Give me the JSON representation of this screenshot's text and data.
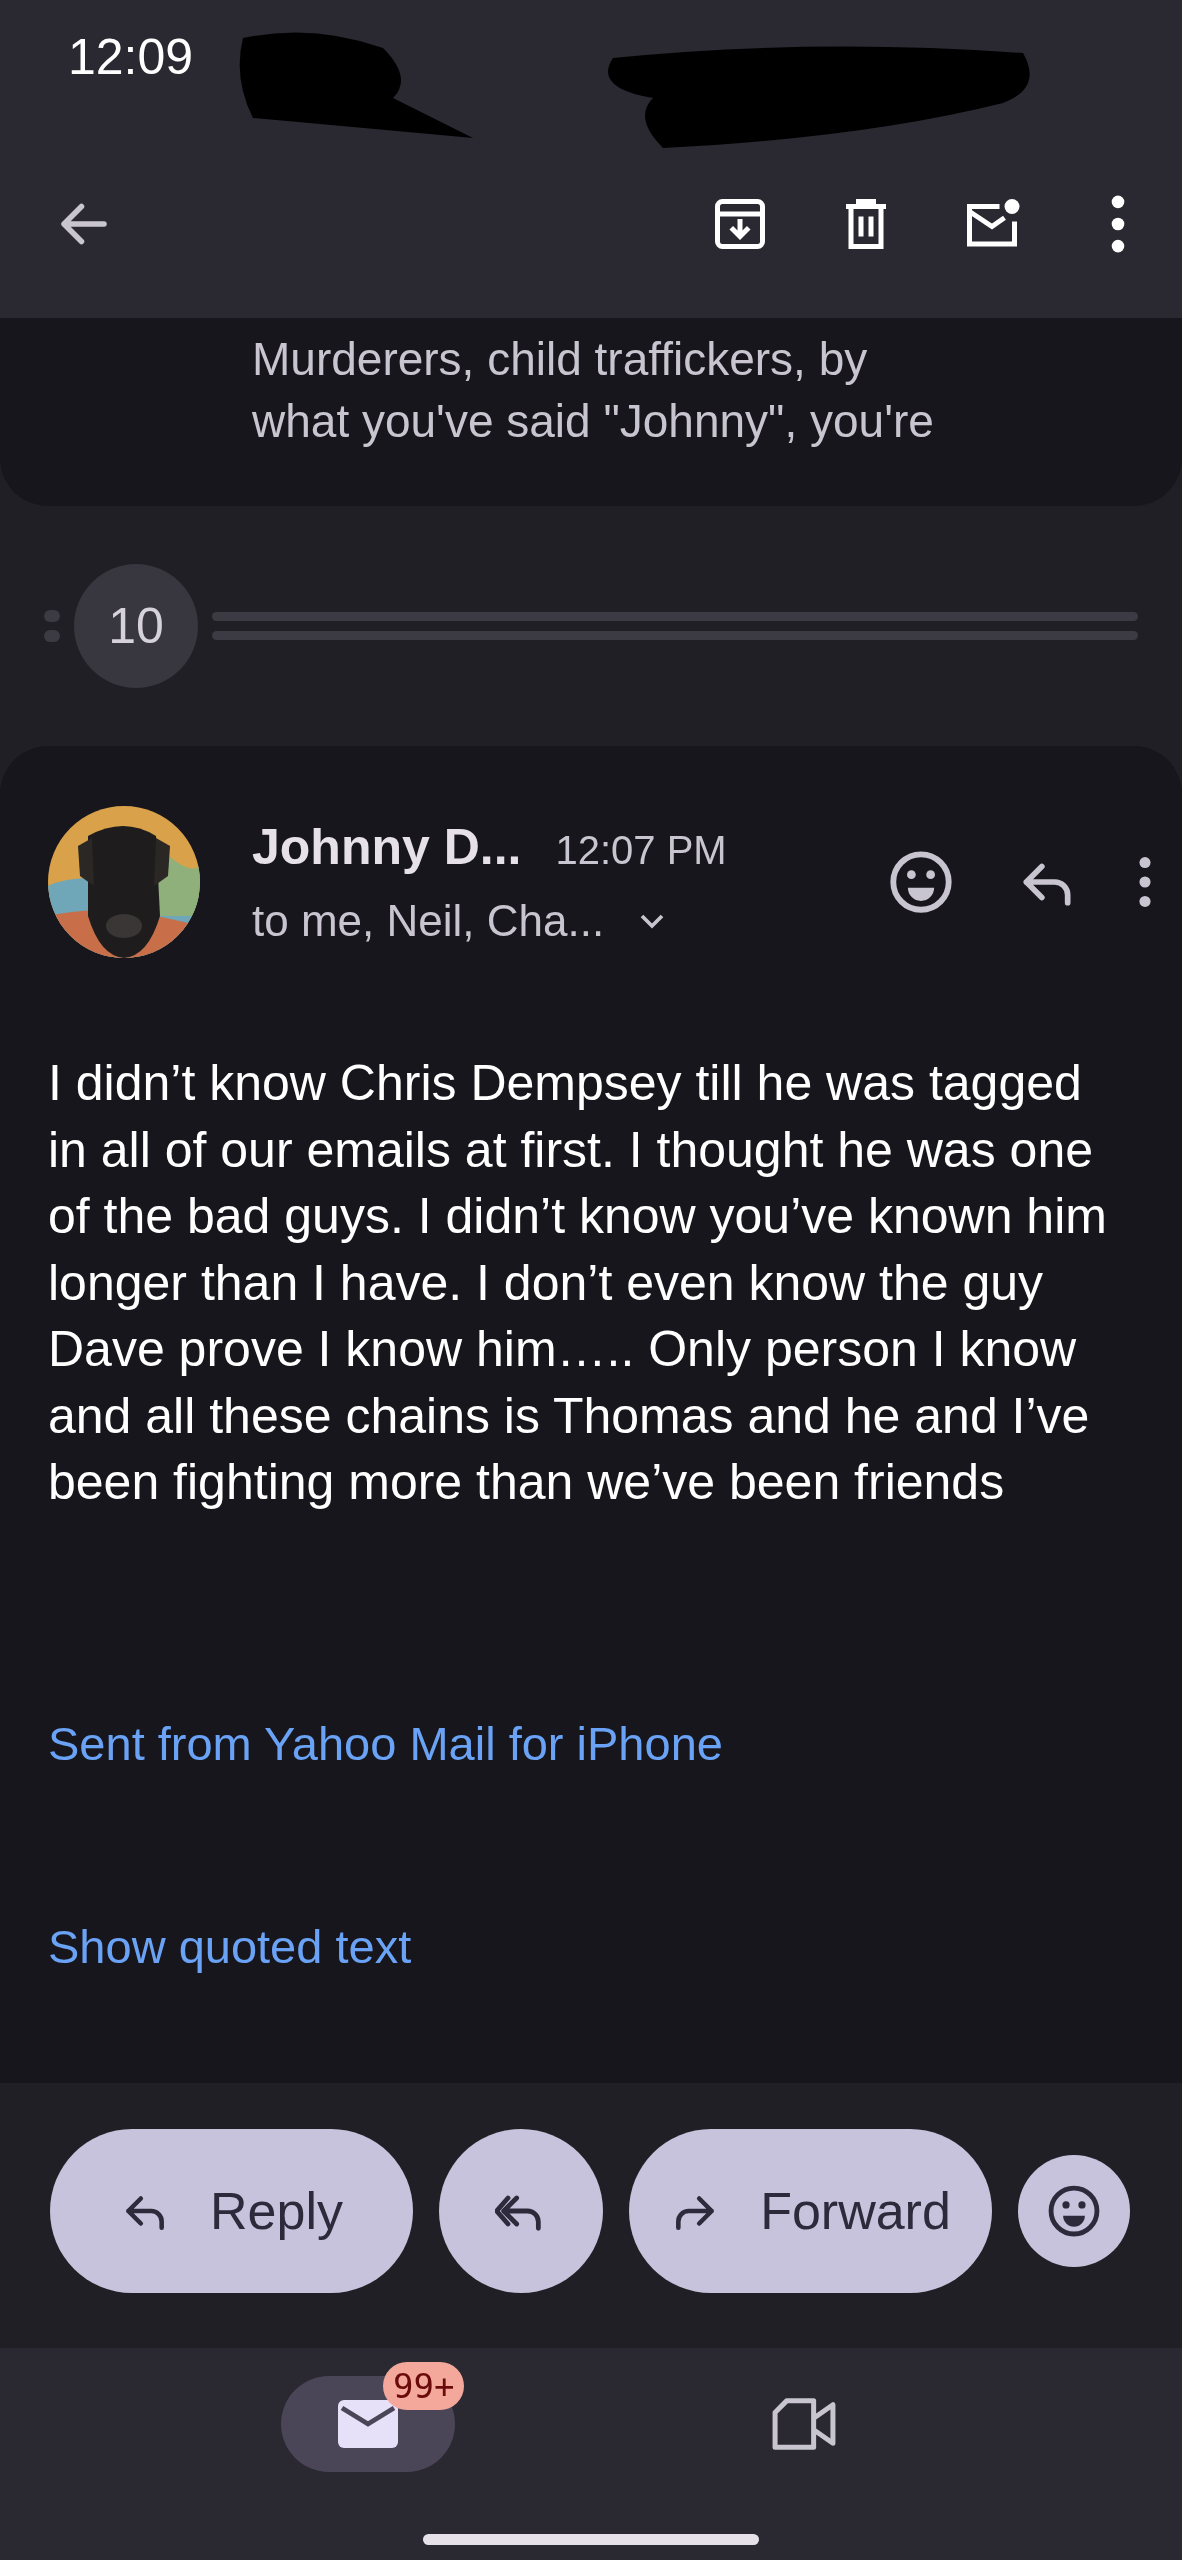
{
  "status_bar": {
    "time": "12:09"
  },
  "prior_message": {
    "snippet_lines": [
      "Murderers, child traffickers, by",
      "what you've said \"Johnny\", you're"
    ]
  },
  "collapsed": {
    "count": "10"
  },
  "message": {
    "sender": "Johnny D...",
    "time": "12:07 PM",
    "recipients": "to me, Neil, Cha...",
    "body": "I didn’t know Chris Dempsey till he was tagged in all of our emails at first. I thought he was one of the bad guys. I didn’t know you’ve known him longer than I have. I don’t even know the guy Dave prove I know him….. Only person I know and all these chains is Thomas and he and I’ve been fighting more than we’ve been friends",
    "signature": "Sent from Yahoo Mail for iPhone",
    "quoted_link": "Show quoted text"
  },
  "actions": [
    {
      "kind": "reply",
      "label": "Reply"
    },
    {
      "kind": "reply_all"
    },
    {
      "kind": "forward",
      "label": "Forward"
    },
    {
      "kind": "emoji"
    }
  ],
  "bottom_nav": [
    {
      "kind": "mail",
      "selected": true,
      "badge": "99+"
    },
    {
      "kind": "meet",
      "selected": false
    }
  ]
}
